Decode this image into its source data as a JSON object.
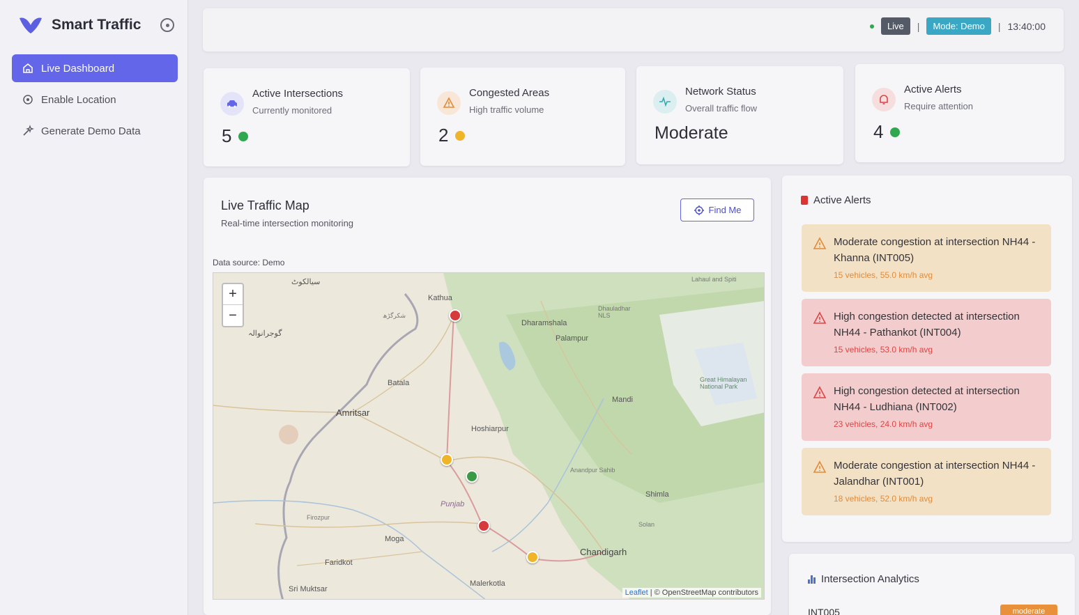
{
  "app": {
    "title": "Smart Traffic"
  },
  "sidebar": {
    "items": [
      {
        "label": "Live Dashboard",
        "icon": "home-icon"
      },
      {
        "label": "Enable Location",
        "icon": "target-icon"
      },
      {
        "label": "Generate Demo Data",
        "icon": "magic-wand-icon"
      }
    ]
  },
  "topbar": {
    "live_label": "Live",
    "mode_label": "Mode: Demo",
    "time": "13:40:00",
    "separator": "|"
  },
  "stats": [
    {
      "title": "Active Intersections",
      "subtitle": "Currently monitored",
      "value": "5",
      "dot_color": "#2fa84f",
      "icon": "car-icon"
    },
    {
      "title": "Congested Areas",
      "subtitle": "High traffic volume",
      "value": "2",
      "dot_color": "#f0b429",
      "icon": "warning-icon"
    },
    {
      "title": "Network Status",
      "subtitle": "Overall traffic flow",
      "value": "Moderate",
      "icon": "pulse-icon"
    },
    {
      "title": "Active Alerts",
      "subtitle": "Require attention",
      "value": "4",
      "dot_color": "#2fa84f",
      "icon": "bell-icon"
    }
  ],
  "map": {
    "title": "Live Traffic Map",
    "subtitle": "Real-time intersection monitoring",
    "find_me": "Find Me",
    "data_source": "Data source: Demo",
    "zoom_in": "+",
    "zoom_out": "−",
    "attribution_leaflet": "Leaflet",
    "attribution_osm": "| © OpenStreetMap contributors",
    "places": {
      "amritsar": "Amritsar",
      "chandigarh": "Chandigarh",
      "batala": "Batala",
      "mandi": "Mandi",
      "shimla": "Shimla",
      "palampur": "Palampur",
      "dharamshala": "Dharamshala",
      "kathua": "Kathua",
      "hoshiarpur": "Hoshiarpur",
      "anandpur": "Anandpur Sahib",
      "moga": "Moga",
      "faridkot": "Faridkot",
      "malerkotla": "Malerkotla",
      "sri_muktsar": "Sri Muktsar",
      "ferozpur": "Firozpur",
      "punjab": "Punjab",
      "solan": "Solan",
      "sialkot": "سیالکوٹ",
      "gujranwala": "گوجرانوالہ",
      "shakargarh": "شکرگڑھ",
      "great_himalayan": "Great Himalayan National Park",
      "lahaul": "Lahaul and Spiti",
      "dhauladhar": "Dhauladhar NLS"
    },
    "markers": [
      {
        "id": "INT004",
        "status": "high",
        "color": "#d63a3a"
      },
      {
        "id": "INT001",
        "status": "moderate",
        "color": "#f0b429"
      },
      {
        "id": "INT003",
        "status": "normal",
        "color": "#3a9a45"
      },
      {
        "id": "INT002",
        "status": "high",
        "color": "#d63a3a"
      },
      {
        "id": "INT005",
        "status": "moderate",
        "color": "#f0b429"
      }
    ]
  },
  "alerts": {
    "title": "Active Alerts",
    "items": [
      {
        "level": "moderate",
        "message": "Moderate congestion at intersection NH44 - Khanna (INT005)",
        "meta": "15 vehicles, 55.0 km/h avg"
      },
      {
        "level": "high",
        "message": "High congestion detected at intersection NH44 - Pathankot (INT004)",
        "meta": "15 vehicles, 53.0 km/h avg"
      },
      {
        "level": "high",
        "message": "High congestion detected at intersection NH44 - Ludhiana (INT002)",
        "meta": "23 vehicles, 24.0 km/h avg"
      },
      {
        "level": "moderate",
        "message": "Moderate congestion at intersection NH44 - Jalandhar (INT001)",
        "meta": "18 vehicles, 52.0 km/h avg"
      }
    ]
  },
  "analytics": {
    "title": "Intersection Analytics",
    "first_id": "INT005",
    "first_status": "moderate"
  }
}
